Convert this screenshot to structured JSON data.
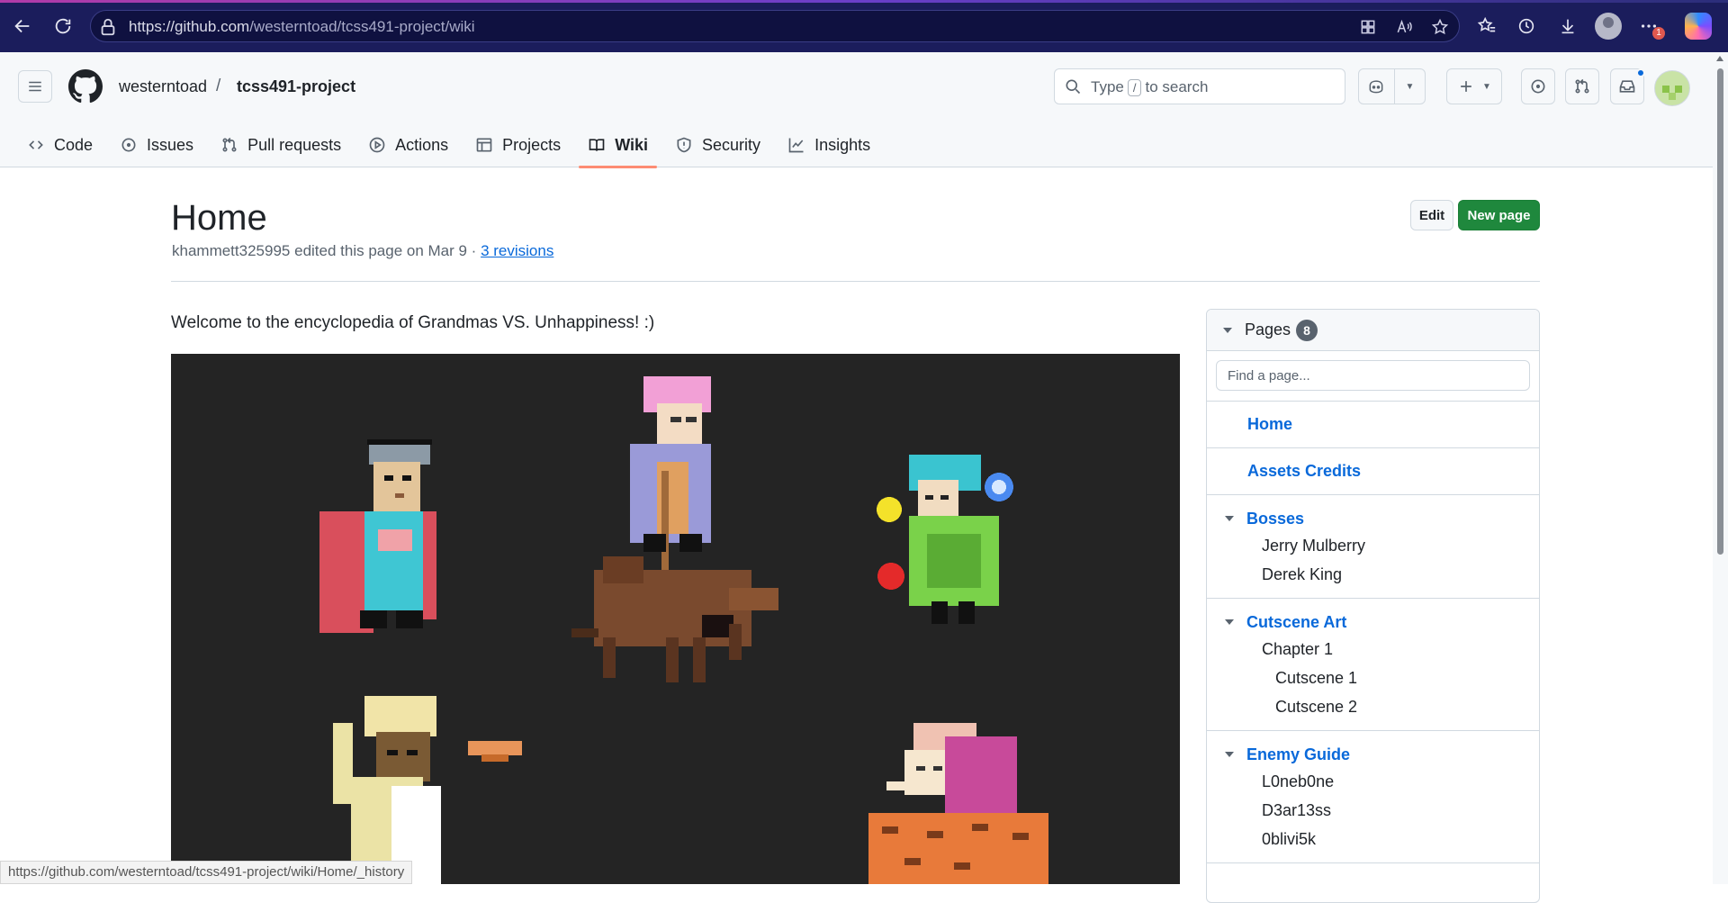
{
  "browser": {
    "url_host": "https://github.com",
    "url_path": "/westerntoad/tcss491-project/wiki",
    "notification_count": "1"
  },
  "header": {
    "owner": "westerntoad",
    "separator": "/",
    "repo": "tcss491-project",
    "search_prefix": "Type",
    "search_key": "/",
    "search_suffix": "to search"
  },
  "repo_nav": {
    "tabs": [
      {
        "label": "Code",
        "icon": "code-icon"
      },
      {
        "label": "Issues",
        "icon": "issue-icon"
      },
      {
        "label": "Pull requests",
        "icon": "pull-request-icon"
      },
      {
        "label": "Actions",
        "icon": "play-icon"
      },
      {
        "label": "Projects",
        "icon": "table-icon"
      },
      {
        "label": "Wiki",
        "icon": "book-icon",
        "selected": true
      },
      {
        "label": "Security",
        "icon": "shield-icon"
      },
      {
        "label": "Insights",
        "icon": "graph-icon"
      }
    ]
  },
  "page": {
    "title": "Home",
    "author": "khammett325995",
    "edit_text": "edited this page on Mar 9 ·",
    "revisions": "3 revisions",
    "edit_button": "Edit",
    "new_page_button": "New page",
    "welcome": "Welcome to the encyclopedia of Grandmas VS. Unhappiness! :)"
  },
  "sidebar": {
    "title": "Pages",
    "count": "8",
    "search_placeholder": "Find a page...",
    "links": [
      {
        "label": "Home"
      },
      {
        "label": "Assets Credits"
      }
    ],
    "groups": [
      {
        "label": "Bosses",
        "children": [
          "Jerry Mulberry",
          "Derek King"
        ]
      },
      {
        "label": "Cutscene Art",
        "children": [
          "Chapter 1"
        ],
        "grandchildren": [
          "Cutscene 1",
          "Cutscene 2"
        ]
      },
      {
        "label": "Enemy Guide",
        "children": [
          "L0neb0ne",
          "D3ar13ss",
          "0blivi5k"
        ]
      }
    ]
  },
  "status_bar": {
    "link_preview": "https://github.com/westerntoad/tcss491-project/wiki/Home/_history"
  },
  "colors": {
    "accent_blue": "#0969da",
    "primary_green": "#1f883d",
    "tab_underline": "#fd8c73",
    "browser_chrome": "#1b1d5c",
    "art_background": "#242424"
  }
}
